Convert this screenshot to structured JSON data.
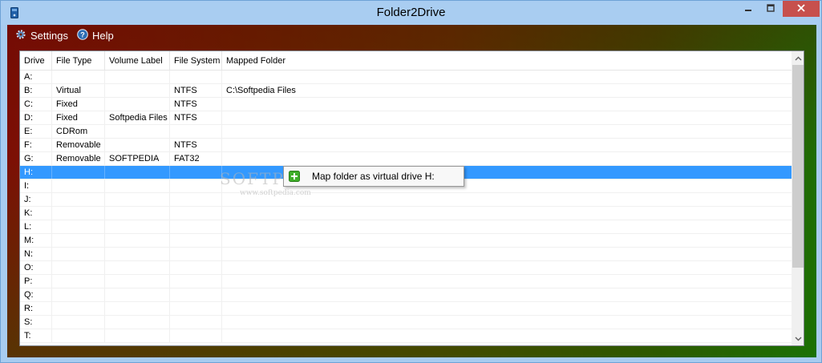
{
  "window": {
    "title": "Folder2Drive",
    "icon": "app-drive-icon"
  },
  "menu": {
    "settings_label": "Settings",
    "help_label": "Help"
  },
  "table": {
    "columns": [
      "Drive",
      "File Type",
      "Volume Label",
      "File System",
      "Mapped Folder"
    ],
    "rows": [
      {
        "drive": "A:",
        "type": "",
        "label": "",
        "fs": "",
        "mapped": ""
      },
      {
        "drive": "B:",
        "type": "Virtual",
        "label": "",
        "fs": "NTFS",
        "mapped": "C:\\Softpedia Files"
      },
      {
        "drive": "C:",
        "type": "Fixed",
        "label": "",
        "fs": "NTFS",
        "mapped": ""
      },
      {
        "drive": "D:",
        "type": "Fixed",
        "label": "Softpedia Files",
        "fs": "NTFS",
        "mapped": ""
      },
      {
        "drive": "E:",
        "type": "CDRom",
        "label": "",
        "fs": "",
        "mapped": ""
      },
      {
        "drive": "F:",
        "type": "Removable",
        "label": "",
        "fs": "NTFS",
        "mapped": ""
      },
      {
        "drive": "G:",
        "type": "Removable",
        "label": "SOFTPEDIA",
        "fs": "FAT32",
        "mapped": ""
      },
      {
        "drive": "H:",
        "type": "",
        "label": "",
        "fs": "",
        "mapped": "",
        "selected": true
      },
      {
        "drive": "I:",
        "type": "",
        "label": "",
        "fs": "",
        "mapped": ""
      },
      {
        "drive": "J:",
        "type": "",
        "label": "",
        "fs": "",
        "mapped": ""
      },
      {
        "drive": "K:",
        "type": "",
        "label": "",
        "fs": "",
        "mapped": ""
      },
      {
        "drive": "L:",
        "type": "",
        "label": "",
        "fs": "",
        "mapped": ""
      },
      {
        "drive": "M:",
        "type": "",
        "label": "",
        "fs": "",
        "mapped": ""
      },
      {
        "drive": "N:",
        "type": "",
        "label": "",
        "fs": "",
        "mapped": ""
      },
      {
        "drive": "O:",
        "type": "",
        "label": "",
        "fs": "",
        "mapped": ""
      },
      {
        "drive": "P:",
        "type": "",
        "label": "",
        "fs": "",
        "mapped": ""
      },
      {
        "drive": "Q:",
        "type": "",
        "label": "",
        "fs": "",
        "mapped": ""
      },
      {
        "drive": "R:",
        "type": "",
        "label": "",
        "fs": "",
        "mapped": ""
      },
      {
        "drive": "S:",
        "type": "",
        "label": "",
        "fs": "",
        "mapped": ""
      },
      {
        "drive": "T:",
        "type": "",
        "label": "",
        "fs": "",
        "mapped": ""
      }
    ]
  },
  "context_menu": {
    "item_label": "Map folder as virtual drive H:",
    "item_icon": "green-plus-icon"
  },
  "watermark": {
    "text": "SOFTPEDIA",
    "sub": "www.softpedia.com"
  },
  "colors": {
    "selection": "#3399ff",
    "close_button": "#c7504d",
    "titlebar": "#a9cdf1"
  }
}
